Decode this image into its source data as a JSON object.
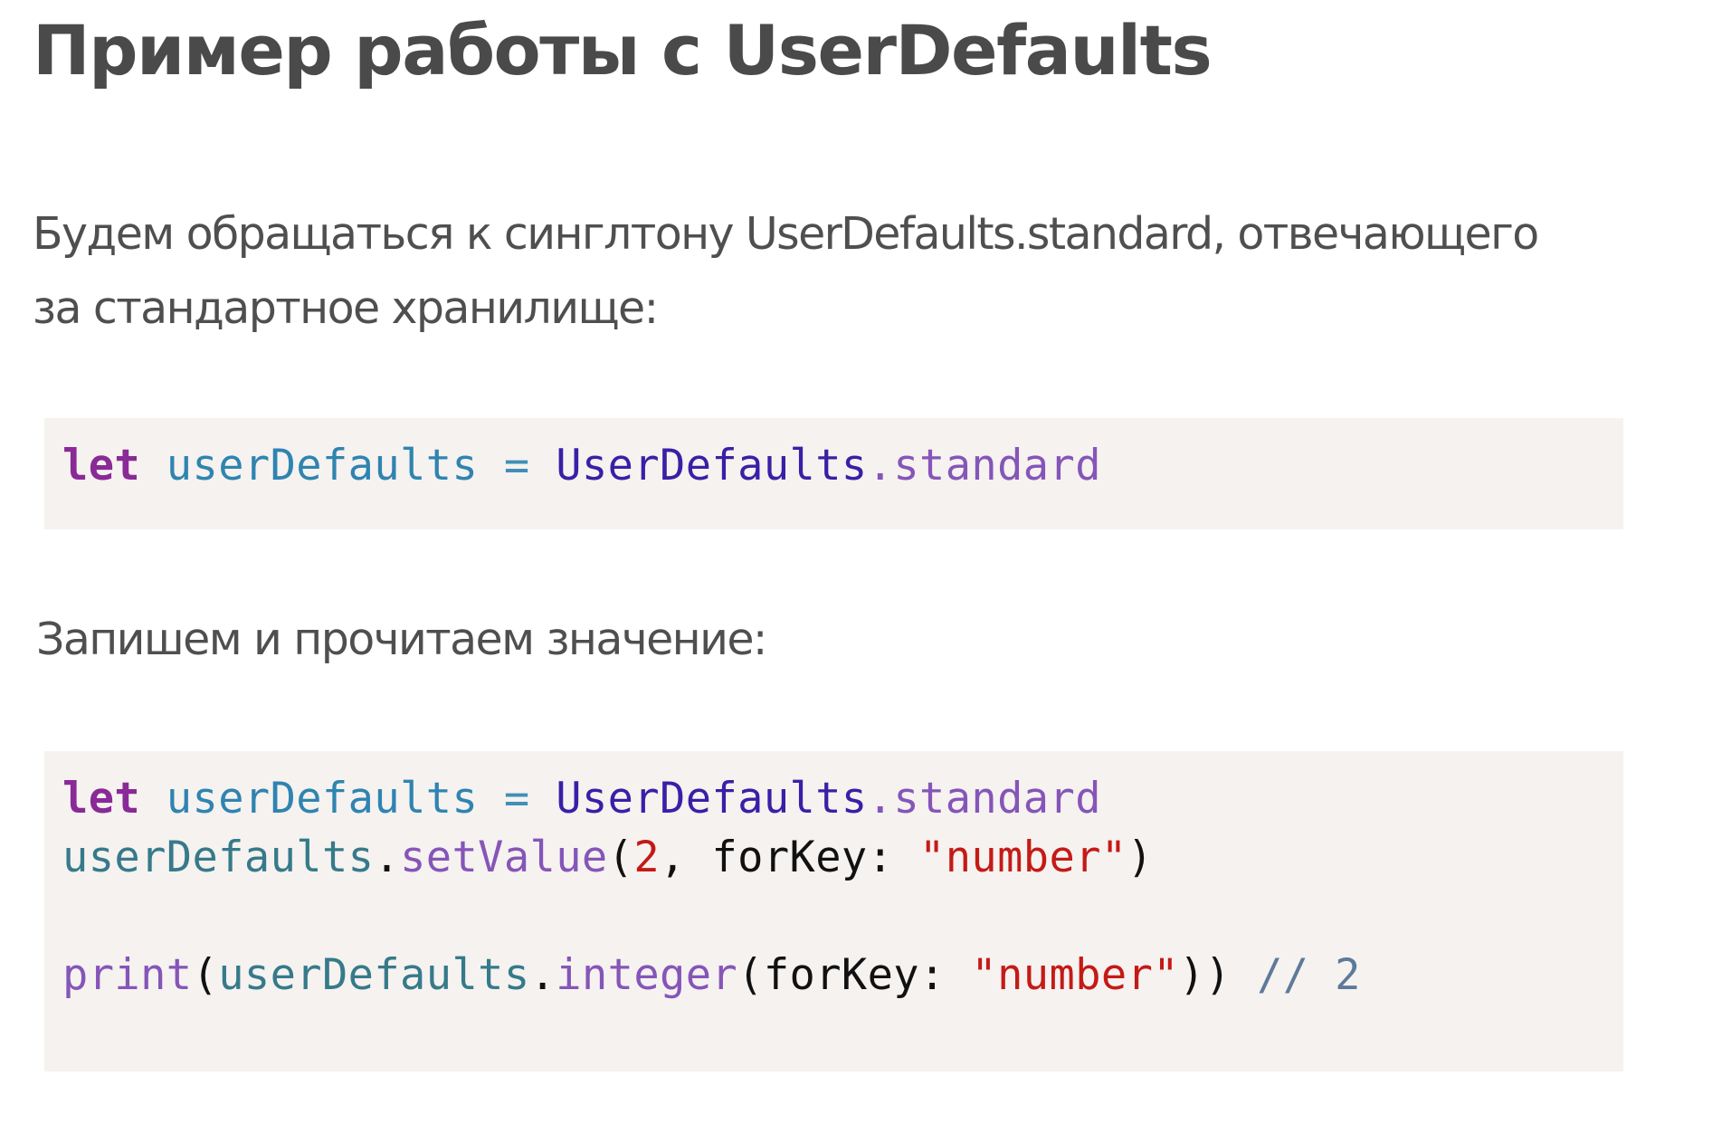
{
  "article": {
    "title": "Пример работы с UserDefaults",
    "paragraph1": {
      "line1": "Будем обращаться к синглтону UserDefaults.standard, отвечающего",
      "line2": "за стандартное хранилище:"
    },
    "paragraph2": "Запишем и прочитаем значение:",
    "code_block1": {
      "line1": {
        "keyword": "let",
        "sp1": " ",
        "var": "userDefaults",
        "sp2": " ",
        "op": "=",
        "sp3": " ",
        "type": "UserDefaults",
        "dot": ".",
        "prop": "standard"
      }
    },
    "code_block2": {
      "line1": {
        "keyword": "let",
        "sp1": " ",
        "var": "userDefaults",
        "sp2": " ",
        "op": "=",
        "sp3": " ",
        "type": "UserDefaults",
        "dot": ".",
        "prop": "standard"
      },
      "line2": {
        "ident": "userDefaults",
        "dot": ".",
        "method": "setValue",
        "paren_open": "(",
        "num": "2",
        "comma": ", forKey: ",
        "str": "\"number\"",
        "paren_close": ")"
      },
      "line4": {
        "func": "print",
        "paren_open": "(",
        "ident": "userDefaults",
        "dot": ".",
        "method": "integer",
        "args": "(forKey: ",
        "str": "\"number\"",
        "paren_close": "))",
        "sp": " ",
        "comment": "// 2"
      }
    }
  }
}
